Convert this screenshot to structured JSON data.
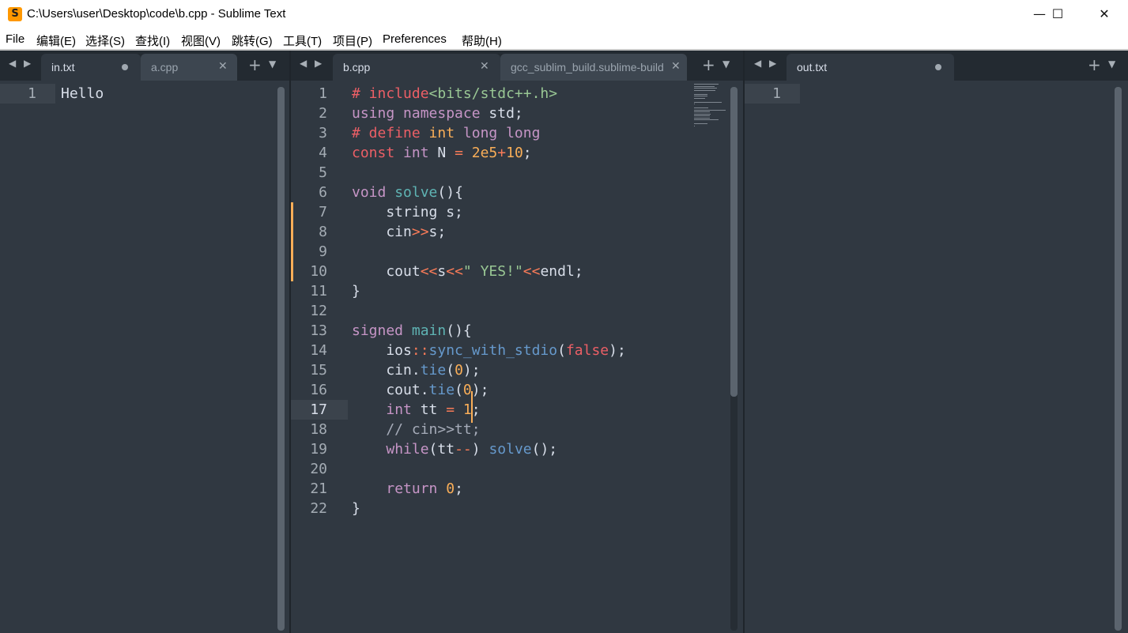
{
  "window": {
    "title": "C:\\Users\\user\\Desktop\\code\\b.cpp - Sublime Text",
    "logo_glyph": "S",
    "minimize": "—",
    "maximize": "☐",
    "close": "✕"
  },
  "menu": [
    "File",
    "编辑(E)",
    "选择(S)",
    "查找(I)",
    "视图(V)",
    "跳转(G)",
    "工具(T)",
    "项目(P)",
    "Preferences",
    "帮助(H)"
  ],
  "panes": [
    {
      "tabs": [
        {
          "label": "in.txt",
          "active": true,
          "indicator": "dirty-dot"
        },
        {
          "label": "a.cpp",
          "active": false,
          "indicator": "close-x"
        }
      ],
      "lines": [
        "Hello"
      ],
      "line_numbers": [
        "1"
      ]
    },
    {
      "tabs": [
        {
          "label": "b.cpp",
          "active": true,
          "indicator": "close-x"
        },
        {
          "label": "gcc_sublim_build.sublime-build",
          "active": false,
          "indicator": "close-x"
        }
      ],
      "line_numbers": [
        "1",
        "2",
        "3",
        "4",
        "5",
        "6",
        "7",
        "8",
        "9",
        "10",
        "11",
        "12",
        "13",
        "14",
        "15",
        "16",
        "17",
        "18",
        "19",
        "20",
        "21",
        "22"
      ],
      "current_line": "17",
      "modified_lines": "7-10"
    },
    {
      "tabs": [
        {
          "label": "out.txt",
          "active": true,
          "indicator": "dirty-dot"
        }
      ],
      "line_numbers": [
        "1"
      ]
    }
  ],
  "tab_controls": {
    "plus": "+",
    "menu": "▼",
    "nav": "◀ ▶",
    "close": "✕"
  },
  "code": [
    [
      [
        "# include",
        "c-pp"
      ],
      [
        "<bits/stdc++.h>",
        "c-inc"
      ]
    ],
    [
      [
        "using",
        "c-kw"
      ],
      [
        " ",
        ""
      ],
      [
        "namespace",
        "c-kw"
      ],
      [
        " std;",
        ""
      ]
    ],
    [
      [
        "# define",
        "c-pp"
      ],
      [
        " ",
        ""
      ],
      [
        "int",
        "c-num"
      ],
      [
        " ",
        ""
      ],
      [
        "long long",
        "c-kw"
      ]
    ],
    [
      [
        "const",
        "c-bool"
      ],
      [
        " ",
        ""
      ],
      [
        "int",
        "c-kw"
      ],
      [
        " N ",
        ""
      ],
      [
        "=",
        "c-op"
      ],
      [
        " ",
        ""
      ],
      [
        "2e5",
        "c-num"
      ],
      [
        "+",
        "c-op"
      ],
      [
        "10",
        "c-num"
      ],
      [
        ";",
        ""
      ]
    ],
    [],
    [
      [
        "void",
        "c-kw"
      ],
      [
        " ",
        ""
      ],
      [
        "solve",
        "c-fn"
      ],
      [
        "(){",
        ""
      ]
    ],
    [
      [
        "    string s;",
        ""
      ]
    ],
    [
      [
        "    cin",
        ""
      ],
      [
        ">>",
        "c-op"
      ],
      [
        "s;",
        ""
      ]
    ],
    [],
    [
      [
        "    cout",
        ""
      ],
      [
        "<<",
        "c-op"
      ],
      [
        "s",
        ""
      ],
      [
        "<<",
        "c-op"
      ],
      [
        "\" YES!\"",
        "c-str"
      ],
      [
        "<<",
        "c-op"
      ],
      [
        "endl;",
        ""
      ]
    ],
    [
      [
        "}",
        ""
      ]
    ],
    [],
    [
      [
        "signed",
        "c-kw"
      ],
      [
        " ",
        ""
      ],
      [
        "main",
        "c-fn"
      ],
      [
        "(){",
        ""
      ]
    ],
    [
      [
        "    ios",
        ""
      ],
      [
        "::",
        "c-op"
      ],
      [
        "sync_with_stdio",
        "c-meth"
      ],
      [
        "(",
        ""
      ],
      [
        "false",
        "c-bool"
      ],
      [
        ");",
        ""
      ]
    ],
    [
      [
        "    cin",
        ""
      ],
      [
        ".",
        ""
      ],
      [
        "tie",
        "c-meth"
      ],
      [
        "(",
        ""
      ],
      [
        "0",
        "c-num"
      ],
      [
        ");",
        ""
      ]
    ],
    [
      [
        "    cout",
        ""
      ],
      [
        ".",
        ""
      ],
      [
        "tie",
        "c-meth"
      ],
      [
        "(",
        ""
      ],
      [
        "0",
        "c-num"
      ],
      [
        ");",
        ""
      ]
    ],
    [
      [
        "    ",
        ""
      ],
      [
        "int",
        "c-kw"
      ],
      [
        " tt ",
        ""
      ],
      [
        "=",
        "c-op"
      ],
      [
        " ",
        ""
      ],
      [
        "1",
        "c-num"
      ],
      [
        ";",
        ""
      ]
    ],
    [
      [
        "    // cin>>tt;",
        "c-cmt"
      ]
    ],
    [
      [
        "    ",
        ""
      ],
      [
        "while",
        "c-kw"
      ],
      [
        "(tt",
        ""
      ],
      [
        "--",
        "c-op"
      ],
      [
        ") ",
        ""
      ],
      [
        "solve",
        "c-meth"
      ],
      [
        "();",
        ""
      ]
    ],
    [],
    [
      [
        "    ",
        ""
      ],
      [
        "return",
        "c-kw"
      ],
      [
        " ",
        ""
      ],
      [
        "0",
        "c-num"
      ],
      [
        ";",
        ""
      ]
    ],
    [
      [
        "}",
        ""
      ]
    ]
  ]
}
